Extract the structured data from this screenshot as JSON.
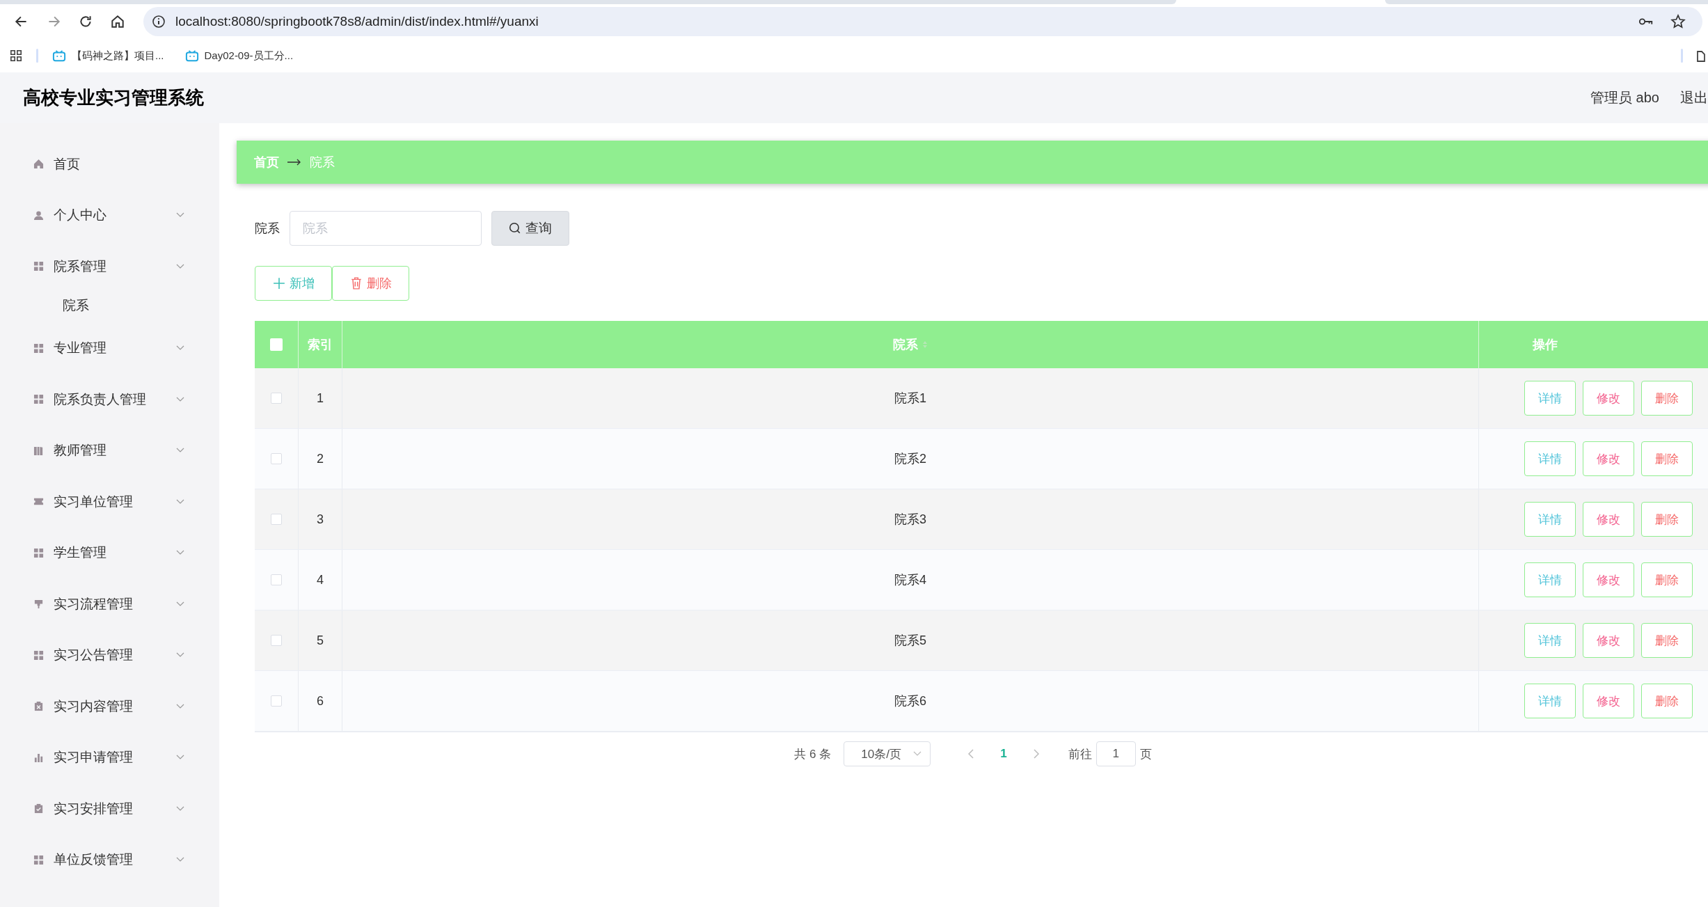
{
  "browser": {
    "url": "localhost:8080/springbootk78s8/admin/dist/index.html#/yuanxi",
    "bookmarks": [
      "【码神之路】项目...",
      "Day02-09-员工分..."
    ]
  },
  "header": {
    "title": "高校专业实习管理系统",
    "user": "管理员 abo",
    "logout": "退出"
  },
  "sidebar": {
    "items": [
      {
        "label": "首页",
        "kind": "link"
      },
      {
        "label": "个人中心",
        "kind": "menu"
      },
      {
        "label": "院系管理",
        "kind": "menu",
        "children": [
          {
            "label": "院系"
          }
        ]
      },
      {
        "label": "专业管理",
        "kind": "menu"
      },
      {
        "label": "院系负责人管理",
        "kind": "menu"
      },
      {
        "label": "教师管理",
        "kind": "menu"
      },
      {
        "label": "实习单位管理",
        "kind": "menu"
      },
      {
        "label": "学生管理",
        "kind": "menu"
      },
      {
        "label": "实习流程管理",
        "kind": "menu"
      },
      {
        "label": "实习公告管理",
        "kind": "menu"
      },
      {
        "label": "实习内容管理",
        "kind": "menu"
      },
      {
        "label": "实习申请管理",
        "kind": "menu"
      },
      {
        "label": "实习安排管理",
        "kind": "menu"
      },
      {
        "label": "单位反馈管理",
        "kind": "menu"
      }
    ]
  },
  "breadcrumb": [
    "首页",
    "院系"
  ],
  "search": {
    "label": "院系",
    "placeholder": "院系",
    "button": "查询"
  },
  "toolbar": [
    {
      "label": "新增",
      "kind": "add"
    },
    {
      "label": "删除",
      "kind": "delete"
    }
  ],
  "table": {
    "select_all": {
      "checked": false
    },
    "columns": [
      "索引",
      "院系",
      "操作"
    ],
    "rows": [
      {
        "checked": false,
        "index": "1",
        "name": "院系1",
        "actions": [
          {
            "label": "详情",
            "kind": "detail"
          },
          {
            "label": "修改",
            "kind": "edit"
          },
          {
            "label": "删除",
            "kind": "delete"
          }
        ]
      },
      {
        "checked": false,
        "index": "2",
        "name": "院系2",
        "actions": [
          {
            "label": "详情",
            "kind": "detail"
          },
          {
            "label": "修改",
            "kind": "edit"
          },
          {
            "label": "删除",
            "kind": "delete"
          }
        ]
      },
      {
        "checked": false,
        "index": "3",
        "name": "院系3",
        "actions": [
          {
            "label": "详情",
            "kind": "detail"
          },
          {
            "label": "修改",
            "kind": "edit"
          },
          {
            "label": "删除",
            "kind": "delete"
          }
        ]
      },
      {
        "checked": false,
        "index": "4",
        "name": "院系4",
        "actions": [
          {
            "label": "详情",
            "kind": "detail"
          },
          {
            "label": "修改",
            "kind": "edit"
          },
          {
            "label": "删除",
            "kind": "delete"
          }
        ]
      },
      {
        "checked": false,
        "index": "5",
        "name": "院系5",
        "actions": [
          {
            "label": "详情",
            "kind": "detail"
          },
          {
            "label": "修改",
            "kind": "edit"
          },
          {
            "label": "删除",
            "kind": "delete"
          }
        ]
      },
      {
        "checked": false,
        "index": "6",
        "name": "院系6",
        "actions": [
          {
            "label": "详情",
            "kind": "detail"
          },
          {
            "label": "修改",
            "kind": "edit"
          },
          {
            "label": "删除",
            "kind": "delete"
          }
        ]
      }
    ]
  },
  "pagination": {
    "total": "共 6 条",
    "page_size": "10条/页",
    "pages": [
      {
        "label": "1",
        "selected": true
      }
    ],
    "goto_label": "前往",
    "goto_value": "1",
    "goto_suffix": "页"
  }
}
